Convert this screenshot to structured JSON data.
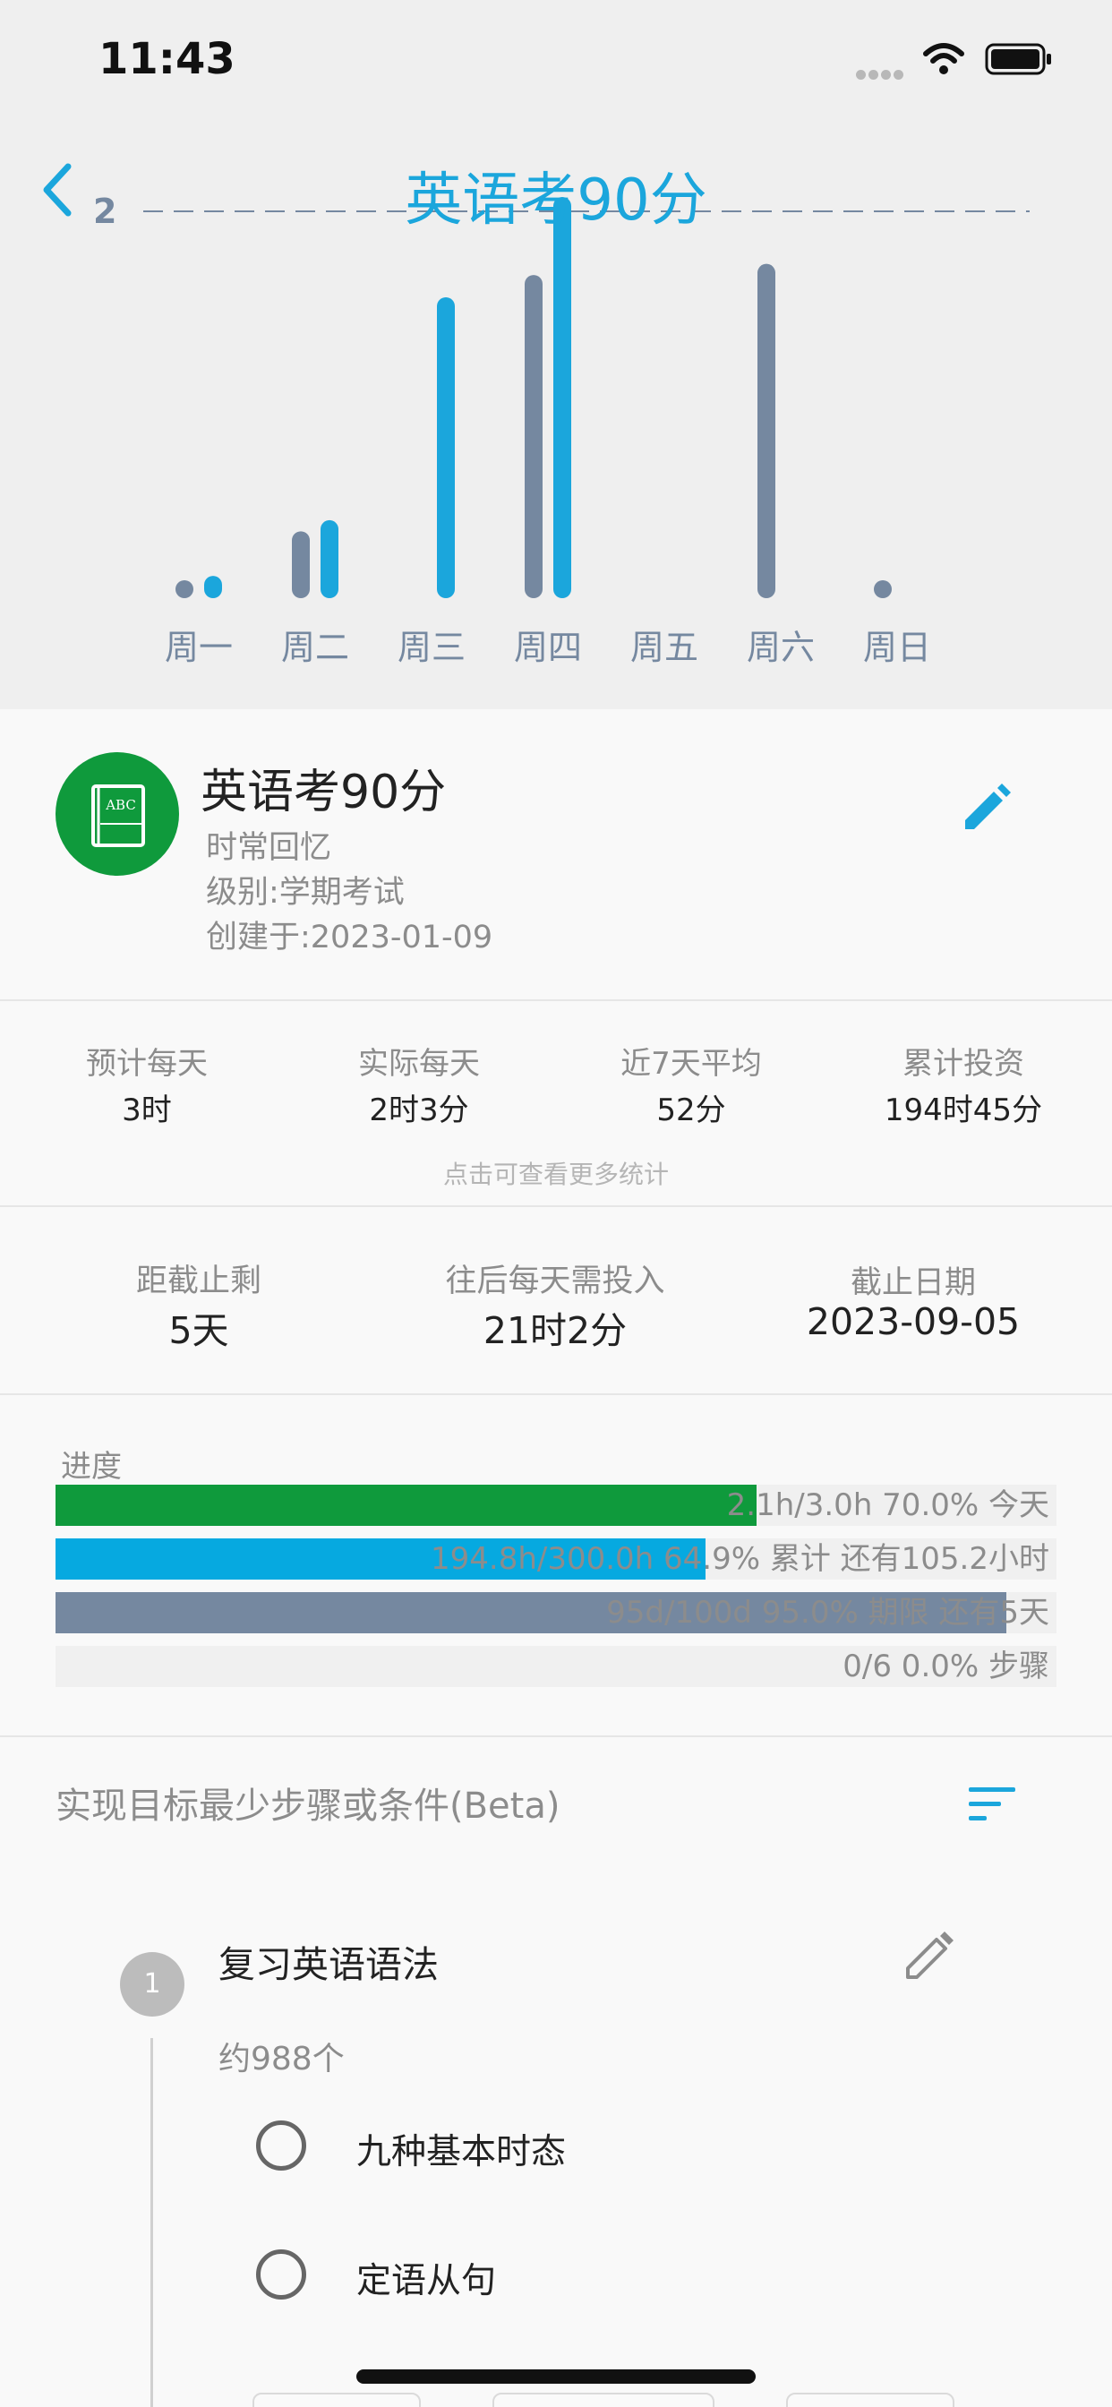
{
  "status_bar": {
    "time": "11:43"
  },
  "header": {
    "back_count": "2",
    "title": "英语考90分"
  },
  "chart_data": {
    "type": "bar",
    "categories": [
      "周一",
      "周二",
      "周三",
      "周四",
      "周五",
      "周六",
      "周日"
    ],
    "series": [
      {
        "color": "#7588a0",
        "values": [
          1,
          6,
          0,
          29,
          0,
          30,
          1
        ]
      },
      {
        "color": "#1ba6dc",
        "values": [
          2,
          7,
          27,
          36,
          0,
          0,
          0
        ]
      }
    ],
    "ylim": [
      0,
      36
    ],
    "reference_line": "dashed",
    "grid": false
  },
  "goal": {
    "icon": "book-icon",
    "icon_text": "ABC",
    "title": "英语考90分",
    "subtitle": "时常回忆",
    "level": "级别:学期考试",
    "created": "创建于:2023-01-09",
    "accent": "#0f9a3c"
  },
  "stats": [
    {
      "label": "预计每天",
      "value": "3时"
    },
    {
      "label": "实际每天",
      "value": "2时3分"
    },
    {
      "label": "近7天平均",
      "value": "52分"
    },
    {
      "label": "累计投资",
      "value": "194时45分"
    }
  ],
  "stats_hint": "点击可查看更多统计",
  "deadline": [
    {
      "label": "距截止剩",
      "value": "5天"
    },
    {
      "label": "往后每天需投入",
      "value": "21时2分"
    },
    {
      "label": "截止日期",
      "value": "2023-09-05"
    }
  ],
  "progress": {
    "label": "进度",
    "bars": [
      {
        "text": "2.1h/3.0h 70.0% 今天",
        "fraction": 0.7,
        "color": "#0f9a3c"
      },
      {
        "text": "194.8h/300.0h 64.9% 累计 还有105.2小时",
        "fraction": 0.649,
        "color": "#06a9e0"
      },
      {
        "text": "95d/100d 95.0% 期限 还有5天",
        "fraction": 0.95,
        "color": "#7588a0"
      },
      {
        "text": "0/6 0.0% 步骤",
        "fraction": 0.0,
        "color": "#7588a0"
      }
    ]
  },
  "steps": {
    "heading": "实现目标最少步骤或条件(Beta)",
    "items": [
      {
        "number": "1",
        "title": "复习英语语法",
        "count": "约988个",
        "subtasks": [
          "九种基本时态",
          "定语从句"
        ]
      }
    ]
  }
}
